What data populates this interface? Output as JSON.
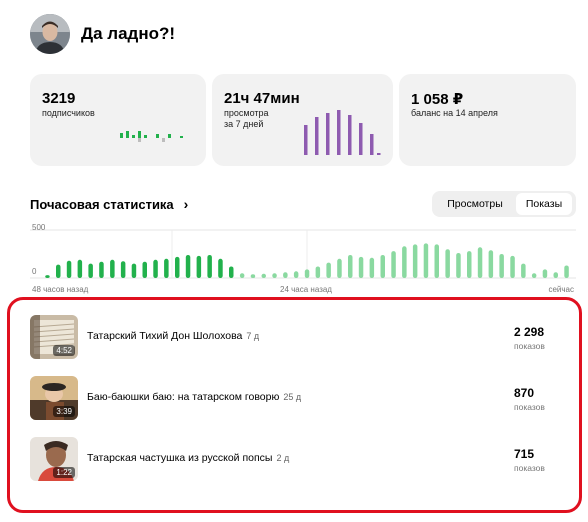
{
  "channel": {
    "name": "Да ладно?!"
  },
  "stats": {
    "subscribers": {
      "value": "3219",
      "label": "подписчиков"
    },
    "watch_time": {
      "value": "21ч 47мин",
      "label_line1": "просмотра",
      "label_line2": "за 7 дней"
    },
    "balance": {
      "value": "1 058 ₽",
      "label": "баланс на 14 апреля"
    }
  },
  "hourly": {
    "title": "Почасовая статистика",
    "chevron": "›",
    "tabs": [
      "Просмотры",
      "Показы"
    ],
    "active_tab": "Показы",
    "y_max_label": "500",
    "y_min_label": "0",
    "x_labels": [
      "48 часов назад",
      "24 часа назад",
      "сейчас"
    ]
  },
  "videos": [
    {
      "title": "Татарский Тихий Дон Шолохова",
      "age": "7 д",
      "duration": "4:52",
      "count": "2 298",
      "count_label": "показов"
    },
    {
      "title": "Баю-баюшки баю: на татарском говорю",
      "age": "25 д",
      "duration": "3:39",
      "count": "870",
      "count_label": "показов"
    },
    {
      "title": "Татарская частушка из русской попсы",
      "age": "2 д",
      "duration": "1:22",
      "count": "715",
      "count_label": "показов"
    }
  ],
  "colors": {
    "green_dark": "#22b14c",
    "green_light": "#8ad9a0",
    "purple": "#8e5bb0",
    "highlight_border": "#e0101f"
  },
  "chart_data": [
    {
      "type": "bar",
      "x": [
        "-48",
        "-47",
        "-46",
        "-45",
        "-44",
        "-43",
        "-42",
        "-41",
        "-40",
        "-39",
        "-38",
        "-37",
        "-36",
        "-35",
        "-34",
        "-33",
        "-32",
        "-31",
        "-30",
        "-29",
        "-28",
        "-27",
        "-26",
        "-25",
        "-24",
        "-23",
        "-22",
        "-21",
        "-20",
        "-19",
        "-18",
        "-17",
        "-16",
        "-15",
        "-14",
        "-13",
        "-12",
        "-11",
        "-10",
        "-9",
        "-8",
        "-7",
        "-6",
        "-5",
        "-4",
        "-3",
        "-2",
        "-1",
        "0"
      ],
      "values": [
        30,
        140,
        180,
        190,
        150,
        170,
        190,
        175,
        150,
        170,
        190,
        200,
        220,
        240,
        230,
        240,
        200,
        120,
        50,
        40,
        45,
        50,
        60,
        70,
        90,
        120,
        160,
        200,
        240,
        220,
        210,
        240,
        280,
        330,
        350,
        360,
        350,
        300,
        260,
        280,
        320,
        290,
        250,
        230,
        150,
        50,
        90,
        60,
        130
      ],
      "ylim": [
        0,
        500
      ],
      "y_tick_labels": [
        "500",
        "0"
      ],
      "x_tick_labels": [
        "48 часов назад",
        "24 часа назад",
        "сейчас"
      ]
    }
  ]
}
